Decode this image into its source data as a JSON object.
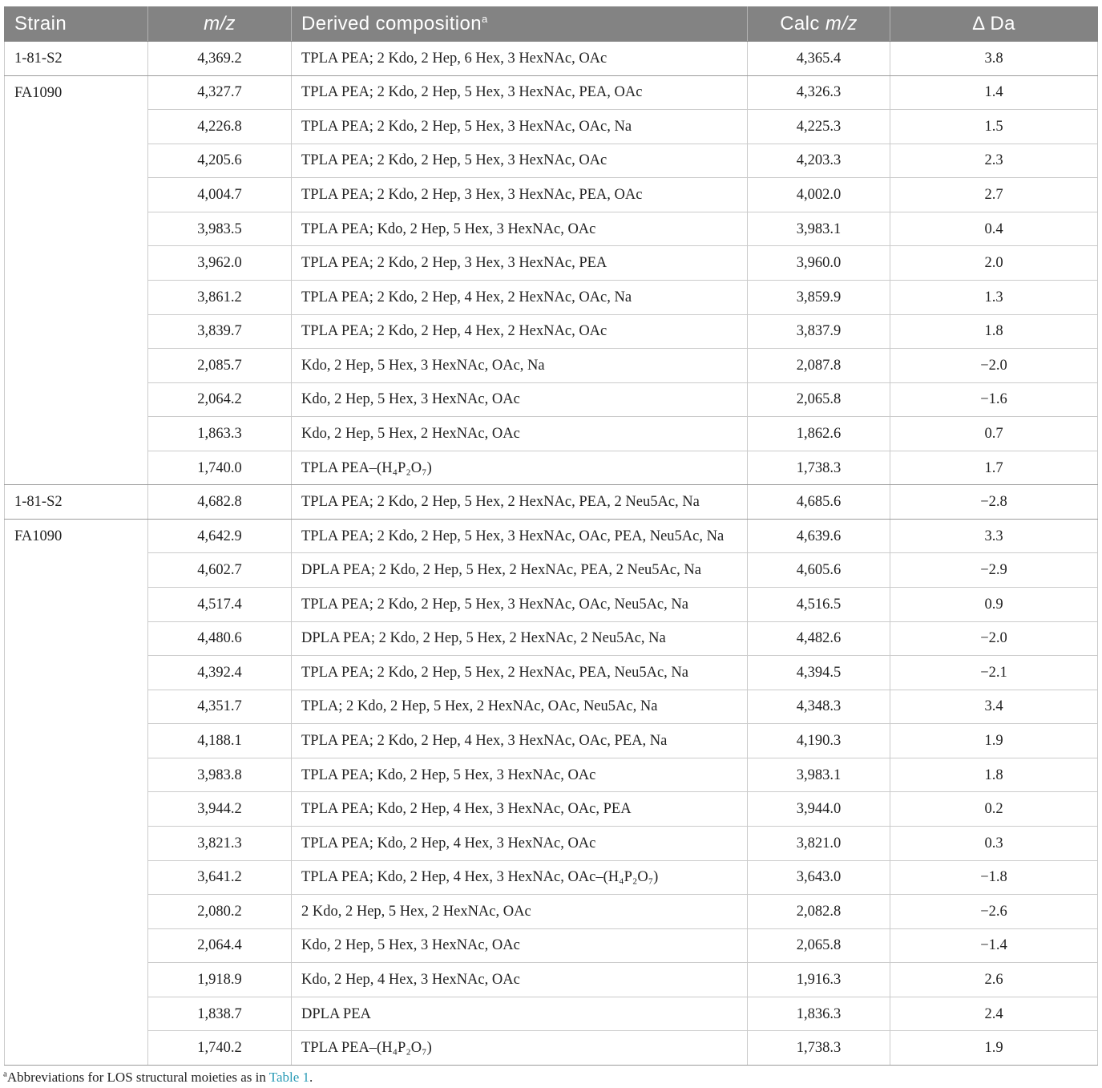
{
  "header": {
    "strain": "Strain",
    "mz": "m/z",
    "composition": "Derived composition",
    "composition_note": "a",
    "calc_prefix": "Calc",
    "calc_mz": "m/z",
    "delta": "Δ Da"
  },
  "groups": [
    {
      "strain": "1-81-S2",
      "rows": [
        {
          "mz": "4,369.2",
          "composition": "TPLA PEA; 2 Kdo, 2 Hep, 6 Hex, 3 HexNAc, OAc",
          "calc_mz": "4,365.4",
          "delta_da": "3.8"
        }
      ]
    },
    {
      "strain": "FA1090",
      "rows": [
        {
          "mz": "4,327.7",
          "composition": "TPLA PEA; 2 Kdo, 2 Hep, 5 Hex, 3 HexNAc, PEA, OAc",
          "calc_mz": "4,326.3",
          "delta_da": "1.4"
        },
        {
          "mz": "4,226.8",
          "composition": "TPLA PEA; 2 Kdo, 2 Hep, 5 Hex, 3 HexNAc, OAc, Na",
          "calc_mz": "4,225.3",
          "delta_da": "1.5"
        },
        {
          "mz": "4,205.6",
          "composition": "TPLA PEA; 2 Kdo, 2 Hep, 5 Hex, 3 HexNAc, OAc",
          "calc_mz": "4,203.3",
          "delta_da": "2.3"
        },
        {
          "mz": "4,004.7",
          "composition": "TPLA PEA; 2 Kdo, 2 Hep, 3 Hex, 3 HexNAc, PEA, OAc",
          "calc_mz": "4,002.0",
          "delta_da": "2.7"
        },
        {
          "mz": "3,983.5",
          "composition": "TPLA PEA; Kdo, 2 Hep, 5 Hex, 3 HexNAc, OAc",
          "calc_mz": "3,983.1",
          "delta_da": "0.4"
        },
        {
          "mz": "3,962.0",
          "composition": "TPLA PEA; 2 Kdo, 2 Hep, 3 Hex, 3 HexNAc, PEA",
          "calc_mz": "3,960.0",
          "delta_da": "2.0"
        },
        {
          "mz": "3,861.2",
          "composition": "TPLA PEA; 2 Kdo, 2 Hep, 4 Hex, 2 HexNAc, OAc, Na",
          "calc_mz": "3,859.9",
          "delta_da": "1.3"
        },
        {
          "mz": "3,839.7",
          "composition": "TPLA PEA; 2 Kdo, 2 Hep, 4 Hex, 2 HexNAc, OAc",
          "calc_mz": "3,837.9",
          "delta_da": "1.8"
        },
        {
          "mz": "2,085.7",
          "composition": "Kdo, 2 Hep, 5 Hex, 3 HexNAc, OAc, Na",
          "calc_mz": "2,087.8",
          "delta_da": "−2.0"
        },
        {
          "mz": "2,064.2",
          "composition": "Kdo, 2 Hep, 5 Hex, 3 HexNAc, OAc",
          "calc_mz": "2,065.8",
          "delta_da": "−1.6"
        },
        {
          "mz": "1,863.3",
          "composition": "Kdo, 2 Hep, 5 Hex, 2 HexNAc, OAc",
          "calc_mz": "1,862.6",
          "delta_da": "0.7"
        },
        {
          "mz": "1,740.0",
          "composition": "TPLA PEA–(H₄P₂O₇)",
          "calc_mz": "1,738.3",
          "delta_da": "1.7"
        }
      ]
    },
    {
      "strain": "1-81-S2",
      "rows": [
        {
          "mz": "4,682.8",
          "composition": "TPLA PEA; 2 Kdo, 2 Hep, 5 Hex, 2 HexNAc, PEA, 2 Neu5Ac, Na",
          "calc_mz": "4,685.6",
          "delta_da": "−2.8"
        }
      ]
    },
    {
      "strain": "FA1090",
      "rows": [
        {
          "mz": "4,642.9",
          "composition": "TPLA PEA; 2 Kdo, 2 Hep, 5 Hex, 3 HexNAc, OAc, PEA, Neu5Ac, Na",
          "calc_mz": "4,639.6",
          "delta_da": "3.3"
        },
        {
          "mz": "4,602.7",
          "composition": "DPLA PEA; 2 Kdo, 2 Hep, 5 Hex, 2 HexNAc, PEA, 2 Neu5Ac, Na",
          "calc_mz": "4,605.6",
          "delta_da": "−2.9"
        },
        {
          "mz": "4,517.4",
          "composition": "TPLA PEA; 2 Kdo, 2 Hep, 5 Hex, 3 HexNAc, OAc, Neu5Ac, Na",
          "calc_mz": "4,516.5",
          "delta_da": "0.9"
        },
        {
          "mz": "4,480.6",
          "composition": "DPLA PEA; 2 Kdo, 2 Hep, 5 Hex, 2 HexNAc, 2 Neu5Ac, Na",
          "calc_mz": "4,482.6",
          "delta_da": "−2.0"
        },
        {
          "mz": "4,392.4",
          "composition": "TPLA PEA; 2 Kdo, 2 Hep, 5 Hex, 2 HexNAc, PEA, Neu5Ac, Na",
          "calc_mz": "4,394.5",
          "delta_da": "−2.1"
        },
        {
          "mz": "4,351.7",
          "composition": "TPLA; 2 Kdo, 2 Hep, 5 Hex, 2 HexNAc, OAc, Neu5Ac, Na",
          "calc_mz": "4,348.3",
          "delta_da": "3.4"
        },
        {
          "mz": "4,188.1",
          "composition": "TPLA PEA; 2 Kdo, 2 Hep, 4 Hex, 3 HexNAc, OAc, PEA, Na",
          "calc_mz": "4,190.3",
          "delta_da": "1.9"
        },
        {
          "mz": "3,983.8",
          "composition": "TPLA PEA; Kdo, 2 Hep, 5 Hex, 3 HexNAc, OAc",
          "calc_mz": "3,983.1",
          "delta_da": "1.8"
        },
        {
          "mz": "3,944.2",
          "composition": "TPLA PEA; Kdo, 2 Hep, 4 Hex, 3 HexNAc, OAc, PEA",
          "calc_mz": "3,944.0",
          "delta_da": "0.2"
        },
        {
          "mz": "3,821.3",
          "composition": "TPLA PEA; Kdo, 2 Hep, 4 Hex, 3 HexNAc, OAc",
          "calc_mz": "3,821.0",
          "delta_da": "0.3"
        },
        {
          "mz": "3,641.2",
          "composition": "TPLA PEA; Kdo, 2 Hep, 4 Hex, 3 HexNAc, OAc–(H₄P₂O₇)",
          "calc_mz": "3,643.0",
          "delta_da": "−1.8"
        },
        {
          "mz": "2,080.2",
          "composition": "2 Kdo, 2 Hep, 5 Hex, 2 HexNAc, OAc",
          "calc_mz": "2,082.8",
          "delta_da": "−2.6"
        },
        {
          "mz": "2,064.4",
          "composition": "Kdo, 2 Hep, 5 Hex, 3 HexNAc, OAc",
          "calc_mz": "2,065.8",
          "delta_da": "−1.4"
        },
        {
          "mz": "1,918.9",
          "composition": "Kdo, 2 Hep, 4 Hex, 3 HexNAc, OAc",
          "calc_mz": "1,916.3",
          "delta_da": "2.6"
        },
        {
          "mz": "1,838.7",
          "composition": "DPLA PEA",
          "calc_mz": "1,836.3",
          "delta_da": "2.4"
        },
        {
          "mz": "1,740.2",
          "composition": "TPLA PEA–(H₄P₂O₇)",
          "calc_mz": "1,738.3",
          "delta_da": "1.9"
        }
      ]
    }
  ],
  "footnote": {
    "marker": "a",
    "text": "Abbreviations for LOS structural moieties as in ",
    "link": "Table 1",
    "end": "."
  },
  "colors": {
    "header_background": "#838383",
    "header_text": "#ffffff",
    "body_text": "#222222",
    "grid_line": "#cbcbcb",
    "group_line": "#9c9c9c",
    "link": "#2a9bb6"
  }
}
